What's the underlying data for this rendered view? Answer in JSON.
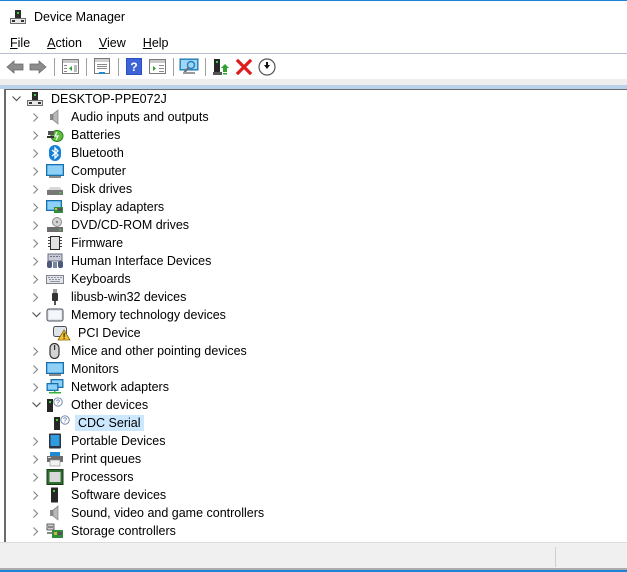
{
  "window": {
    "title": "Device Manager",
    "accent_color": "#1883d7"
  },
  "menu": [
    {
      "label": "File",
      "mnemonic": "F",
      "rest": "ile"
    },
    {
      "label": "Action",
      "mnemonic": "A",
      "rest": "ction"
    },
    {
      "label": "View",
      "mnemonic": "V",
      "rest": "iew"
    },
    {
      "label": "Help",
      "mnemonic": "H",
      "rest": "elp"
    }
  ],
  "toolbar": [
    {
      "name": "back",
      "icon": "back-arrow-icon"
    },
    {
      "name": "forward",
      "icon": "forward-arrow-icon"
    },
    {
      "name": "show-hide-console-tree",
      "icon": "console-tree-icon"
    },
    {
      "name": "properties",
      "icon": "properties-icon"
    },
    {
      "name": "help",
      "icon": "help-icon"
    },
    {
      "name": "show-hide-action-pane",
      "icon": "action-pane-icon"
    },
    {
      "name": "scan-hardware-changes",
      "icon": "scan-monitor-icon"
    },
    {
      "name": "update-driver",
      "icon": "update-driver-icon"
    },
    {
      "name": "uninstall-device",
      "icon": "red-x-icon"
    },
    {
      "name": "disable-device",
      "icon": "down-arrow-circle-icon"
    }
  ],
  "tree": {
    "root": {
      "label": "DESKTOP-PPE072J",
      "expanded": true,
      "icon": "computer-tower-icon"
    },
    "items": [
      {
        "label": "Audio inputs and outputs",
        "icon": "speaker-icon",
        "level": 1,
        "expanded": false
      },
      {
        "label": "Batteries",
        "icon": "battery-icon",
        "level": 1,
        "expanded": false
      },
      {
        "label": "Bluetooth",
        "icon": "bluetooth-icon",
        "level": 1,
        "expanded": false
      },
      {
        "label": "Computer",
        "icon": "monitor-icon",
        "level": 1,
        "expanded": false
      },
      {
        "label": "Disk drives",
        "icon": "disk-drive-icon",
        "level": 1,
        "expanded": false
      },
      {
        "label": "Display adapters",
        "icon": "display-adapter-icon",
        "level": 1,
        "expanded": false
      },
      {
        "label": "DVD/CD-ROM drives",
        "icon": "dvd-drive-icon",
        "level": 1,
        "expanded": false
      },
      {
        "label": "Firmware",
        "icon": "chip-icon",
        "level": 1,
        "expanded": false
      },
      {
        "label": "Human Interface Devices",
        "icon": "hid-icon",
        "level": 1,
        "expanded": false
      },
      {
        "label": "Keyboards",
        "icon": "keyboard-icon",
        "level": 1,
        "expanded": false
      },
      {
        "label": "libusb-win32 devices",
        "icon": "usb-plug-icon",
        "level": 1,
        "expanded": false
      },
      {
        "label": "Memory technology devices",
        "icon": "memory-device-icon",
        "level": 1,
        "expanded": true
      },
      {
        "label": "PCI Device",
        "icon": "warning-device-icon",
        "level": 2,
        "leaf": true
      },
      {
        "label": "Mice and other pointing devices",
        "icon": "mouse-icon",
        "level": 1,
        "expanded": false
      },
      {
        "label": "Monitors",
        "icon": "monitor-icon",
        "level": 1,
        "expanded": false
      },
      {
        "label": "Network adapters",
        "icon": "network-icon",
        "level": 1,
        "expanded": false
      },
      {
        "label": "Other devices",
        "icon": "unknown-device-icon",
        "level": 1,
        "expanded": true
      },
      {
        "label": "CDC Serial",
        "icon": "unknown-device-icon",
        "level": 2,
        "leaf": true,
        "selected": true
      },
      {
        "label": "Portable Devices",
        "icon": "portable-device-icon",
        "level": 1,
        "expanded": false
      },
      {
        "label": "Print queues",
        "icon": "printer-icon",
        "level": 1,
        "expanded": false
      },
      {
        "label": "Processors",
        "icon": "processor-icon",
        "level": 1,
        "expanded": false
      },
      {
        "label": "Software devices",
        "icon": "software-device-icon",
        "level": 1,
        "expanded": false
      },
      {
        "label": "Sound, video and game controllers",
        "icon": "speaker-icon",
        "level": 1,
        "expanded": false
      },
      {
        "label": "Storage controllers",
        "icon": "storage-controller-icon",
        "level": 1,
        "expanded": false
      }
    ]
  },
  "status": {
    "left": "",
    "right": ""
  }
}
